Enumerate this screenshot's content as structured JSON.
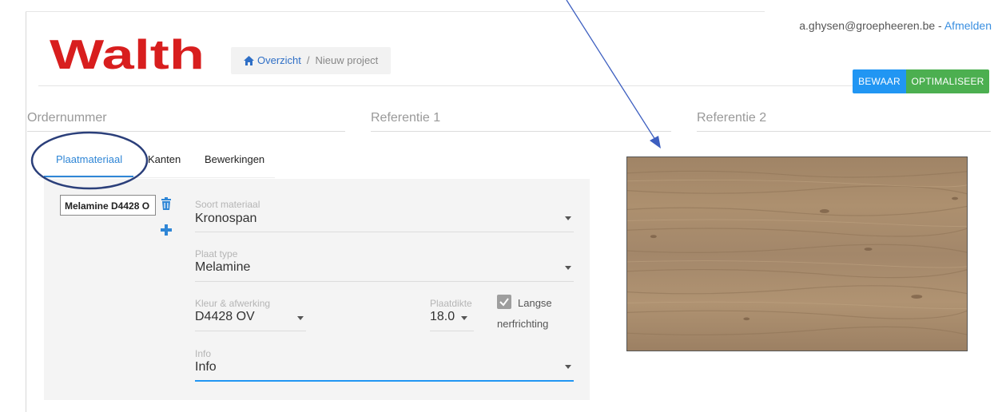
{
  "header": {
    "logo_text": "Walth",
    "breadcrumb": {
      "home_label": "Overzicht",
      "separator": "/",
      "current": "Nieuw project"
    },
    "user": {
      "email": "a.ghysen@groepheeren.be",
      "separator": "-",
      "logout_label": "Afmelden"
    },
    "buttons": {
      "save_label": "BEWAAR",
      "optimize_label": "OPTIMALISEER"
    }
  },
  "fields": {
    "ordernummer": "Ordernummer",
    "referentie1": "Referentie 1",
    "referentie2": "Referentie 2"
  },
  "tabs": [
    {
      "label": "Plaatmateriaal",
      "active": true
    },
    {
      "label": "Kanten",
      "active": false
    },
    {
      "label": "Bewerkingen",
      "active": false
    }
  ],
  "materials": [
    {
      "label": "Melamine D4428 O"
    }
  ],
  "form": {
    "soort_materiaal": {
      "label": "Soort materiaal",
      "value": "Kronospan"
    },
    "plaat_type": {
      "label": "Plaat type",
      "value": "Melamine"
    },
    "kleur": {
      "label": "Kleur & afwerking",
      "value": "D4428 OV"
    },
    "plaatdikte": {
      "label": "Plaatdikte",
      "value": "18.0"
    },
    "langse": {
      "label_line1": "Langse",
      "label_line2": "nerfrichting",
      "checked": true
    },
    "info": {
      "label": "Info",
      "value": "Info"
    }
  },
  "colors": {
    "logo_red": "#d81e1e",
    "accent_blue": "#2196f3",
    "save_blue": "#2196f3",
    "optimize_green": "#4caf50",
    "annotation_navy": "#2b3f7a"
  },
  "icons": {
    "home": "home-icon",
    "trash": "trash-icon",
    "plus": "plus-icon",
    "caret": "caret-down-icon",
    "check": "checkmark-icon"
  }
}
